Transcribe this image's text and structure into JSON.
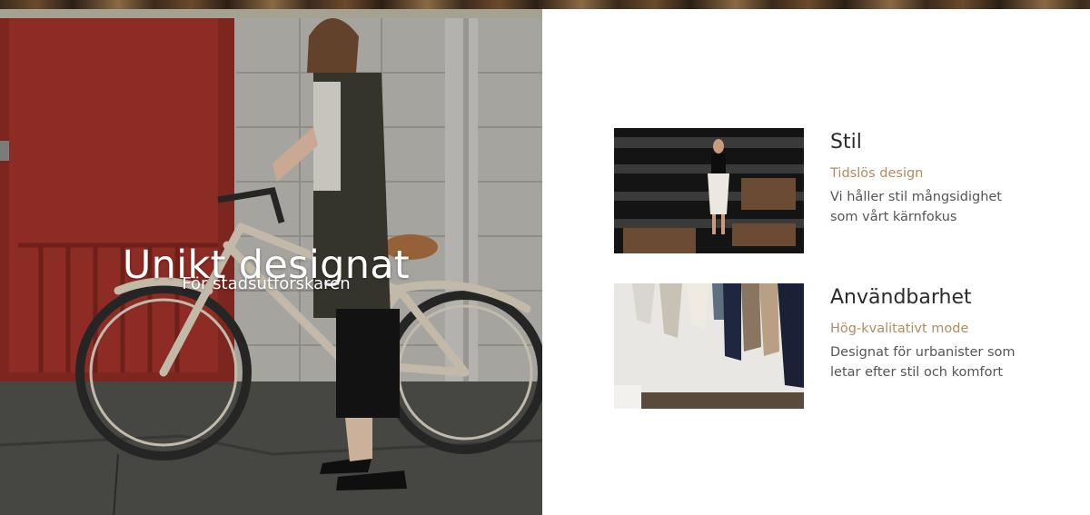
{
  "hero": {
    "title": "Unikt designat",
    "subtitle": "För stadsutforskaren"
  },
  "features": [
    {
      "title": "Stil",
      "tag": "Tidslös design",
      "description": "Vi håller stil mångsidighet som vårt kärnfokus"
    },
    {
      "title": "Användbarhet",
      "tag": "Hög-kvalitativt mode",
      "description": "Designat för urbanister som letar efter stil och komfort"
    }
  ],
  "colors": {
    "accent": "#b08c5e",
    "heading": "#2b2b2b",
    "body_text": "#555555",
    "frame": "#a6a292"
  }
}
